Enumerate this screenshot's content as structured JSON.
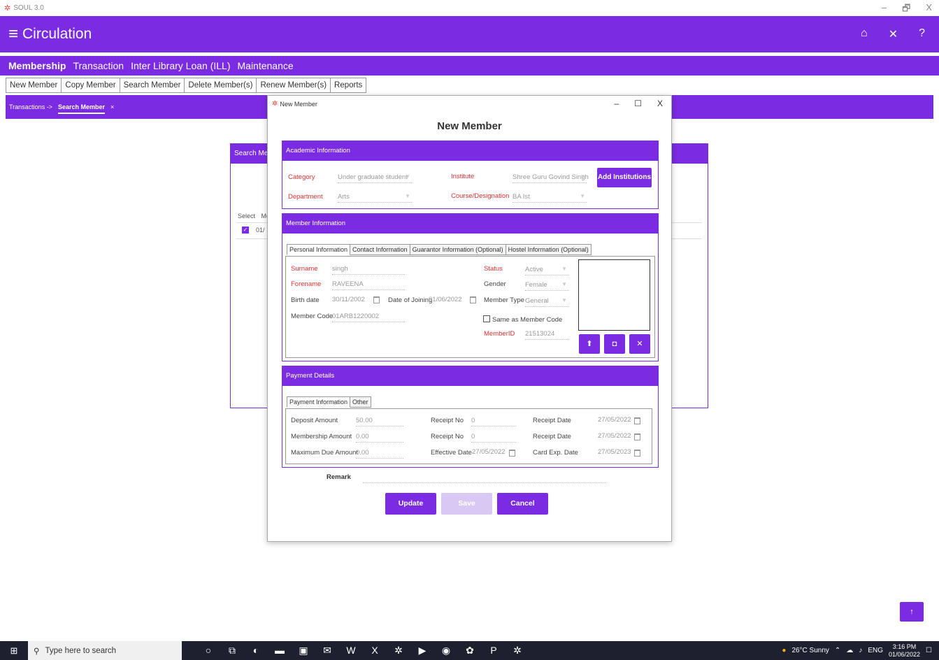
{
  "window": {
    "title": "SOUL 3.0",
    "controls": [
      "–",
      "🗗",
      "X"
    ]
  },
  "app": {
    "title": "Circulation",
    "header_icons": [
      "home-icon",
      "close-icon",
      "help-icon"
    ]
  },
  "menubar": {
    "items": [
      "Membership",
      "Transaction",
      "Inter Library Loan (ILL)",
      "Maintenance"
    ]
  },
  "subbar": {
    "items": [
      "New Member",
      "Copy Member",
      "Search Member",
      "Delete Member(s)",
      "Renew Member(s)",
      "Reports"
    ]
  },
  "breadcrumb": {
    "parent": "Transactions ->",
    "active": "Search Member",
    "close": "×"
  },
  "bgpanel": {
    "title": "Search Memb",
    "col_select": "Select",
    "col_me": "Me",
    "row_code": "01/"
  },
  "dialog": {
    "title": "New Member",
    "heading": "New Member",
    "academic": {
      "title": "Academic Information",
      "category_label": "Category",
      "category_value": "Under graduate student",
      "institute_label": "Institute",
      "institute_value": "Shree Guru Govind Singh",
      "department_label": "Department",
      "department_value": "Arts",
      "course_label": "Course/Designation",
      "course_value": "BA Ist",
      "add_institutions": "Add Institutions"
    },
    "member": {
      "title": "Member Information",
      "tabs": [
        "Personal Information",
        "Contact Information",
        "Guarantor Information (Optional)",
        "Hostel Information (Optional)"
      ],
      "surname_label": "Surname",
      "surname_value": "singh",
      "forename_label": "Forename",
      "forename_value": "RAVEENA",
      "birth_label": "Birth date",
      "birth_value": "30/11/2002",
      "joining_label": "Date of Joining",
      "joining_value": "01/06/2022",
      "code_label": "Member Code",
      "code_value": "01ARB1220002",
      "status_label": "Status",
      "status_value": "Active",
      "gender_label": "Gender",
      "gender_value": "Female",
      "type_label": "Member Type",
      "type_value": "General",
      "same_code_label": "Same as Member Code",
      "memberid_label": "MemberID",
      "memberid_value": "21513024"
    },
    "payment": {
      "title": "Payment Details",
      "tabs": [
        "Payment Information",
        "Other"
      ],
      "deposit_label": "Deposit Amount",
      "deposit_value": "50.00",
      "membership_label": "Membership Amount",
      "membership_value": "0.00",
      "maxdue_label": "Maximum Due Amount",
      "maxdue_value": "0.00",
      "receipt1_label": "Receipt No",
      "receipt1_value": "0",
      "receipt2_label": "Receipt No",
      "receipt2_value": "0",
      "effective_label": "Effective Date",
      "effective_value": "27/05/2022",
      "rdate1_label": "Receipt Date",
      "rdate1_value": "27/05/2022",
      "rdate2_label": "Receipt Date",
      "rdate2_value": "27/05/2022",
      "cardexp_label": "Card Exp. Date",
      "cardexp_value": "27/05/2023"
    },
    "remark_label": "Remark",
    "buttons": {
      "update": "Update",
      "save": "Save",
      "cancel": "Cancel"
    }
  },
  "taskbar": {
    "search_placeholder": "Type here to search",
    "weather": "26°C  Sunny",
    "lang": "ENG",
    "time": "3:16 PM",
    "date": "01/06/2022"
  },
  "colors": {
    "accent": "#7b2be2",
    "required": "#d33333",
    "save_disabled": "#d9c8f3"
  }
}
